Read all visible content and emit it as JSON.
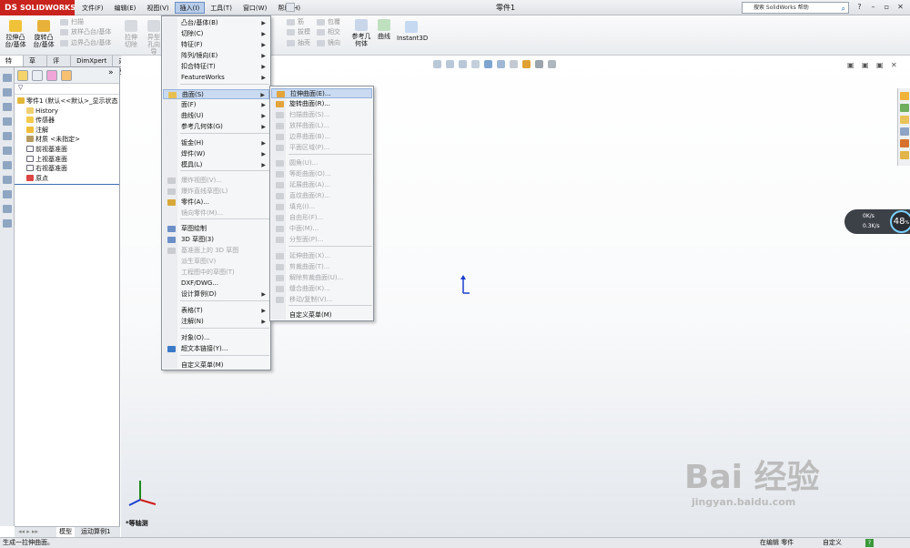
{
  "app": {
    "logo": "SOLIDWORKS",
    "title": "零件1"
  },
  "menubar": [
    "文件(F)",
    "编辑(E)",
    "视图(V)",
    "插入(I)",
    "工具(T)",
    "窗口(W)",
    "帮助(H)"
  ],
  "search": {
    "placeholder": "搜索 SolidWorks 帮助"
  },
  "ribbon": {
    "big": [
      "拉伸凸台/基体",
      "旋转凸台/基体"
    ],
    "small_left": [
      "扫描",
      "放样凸台/基体",
      "边界凸台/基体"
    ],
    "mid_big": [
      "拉伸切除",
      "异型孔向导"
    ],
    "right_small": [
      "筋",
      "包覆",
      "拔模",
      "相交",
      "抽壳",
      "镜向"
    ],
    "ref": "参考几何体",
    "curve": "曲线",
    "instant": "Instant3D"
  },
  "tabs": [
    "特征",
    "草图",
    "评估",
    "DimXpert",
    "办公室产品"
  ],
  "tree": {
    "root": "零件1 (默认<<默认>_显示状态",
    "items": [
      "History",
      "传感器",
      "注解",
      "材质 <未指定>",
      "前视基准面",
      "上视基准面",
      "右视基准面",
      "原点"
    ]
  },
  "insert_menu": [
    {
      "label": "凸台/基体(B)",
      "sub": true
    },
    {
      "label": "切除(C)",
      "sub": true
    },
    {
      "label": "特征(F)",
      "sub": true
    },
    {
      "label": "阵列/镜向(E)",
      "sub": true
    },
    {
      "label": "扣合特征(T)",
      "sub": true
    },
    {
      "label": "FeatureWorks",
      "sub": true
    },
    {
      "label": "曲面(S)",
      "sub": true,
      "highlight": true
    },
    {
      "label": "面(F)",
      "sub": true
    },
    {
      "label": "曲线(U)",
      "sub": true
    },
    {
      "label": "参考几何体(G)",
      "sub": true
    },
    {
      "label": "钣金(H)",
      "sub": true
    },
    {
      "label": "焊件(W)",
      "sub": true
    },
    {
      "label": "模具(L)",
      "sub": true
    },
    {
      "label": "爆炸视图(V)...",
      "disabled": true
    },
    {
      "label": "爆炸直线草图(L)",
      "disabled": true
    },
    {
      "label": "零件(A)..."
    },
    {
      "label": "镜向零件(M)...",
      "disabled": true
    },
    {
      "label": "草图绘制"
    },
    {
      "label": "3D 草图(3)"
    },
    {
      "label": "基准面上的 3D 草图",
      "disabled": true
    },
    {
      "label": "派生草图(V)",
      "disabled": true
    },
    {
      "label": "工程图中的草图(T)",
      "disabled": true
    },
    {
      "label": "DXF/DWG..."
    },
    {
      "label": "设计算例(D)",
      "sub": true
    },
    {
      "label": "表格(T)",
      "sub": true
    },
    {
      "label": "注解(N)",
      "sub": true
    },
    {
      "label": "对象(O)..."
    },
    {
      "label": "超文本链接(Y)..."
    },
    {
      "label": "自定义菜单(M)"
    }
  ],
  "surface_menu": [
    {
      "label": "拉伸曲面(E)...",
      "highlight": true
    },
    {
      "label": "旋转曲面(R)..."
    },
    {
      "label": "扫描曲面(S)...",
      "disabled": true
    },
    {
      "label": "放样曲面(L)...",
      "disabled": true
    },
    {
      "label": "边界曲面(B)...",
      "disabled": true
    },
    {
      "label": "平面区域(P)...",
      "disabled": true
    },
    {
      "label": "圆角(U)...",
      "disabled": true
    },
    {
      "label": "等距曲面(O)...",
      "disabled": true
    },
    {
      "label": "延展曲面(A)...",
      "disabled": true
    },
    {
      "label": "直纹曲面(R)...",
      "disabled": true
    },
    {
      "label": "填充(I)...",
      "disabled": true
    },
    {
      "label": "自由形(F)...",
      "disabled": true
    },
    {
      "label": "中面(M)...",
      "disabled": true
    },
    {
      "label": "分型面(P)...",
      "disabled": true
    },
    {
      "label": "延伸曲面(X)...",
      "disabled": true
    },
    {
      "label": "剪裁曲面(T)...",
      "disabled": true
    },
    {
      "label": "解除剪裁曲面(U)...",
      "disabled": true
    },
    {
      "label": "缝合曲面(K)...",
      "disabled": true
    },
    {
      "label": "移动/复制(V)...",
      "disabled": true
    },
    {
      "label": "自定义菜单(M)"
    }
  ],
  "bottom_tabs": [
    "模型",
    "运动算例1"
  ],
  "triad_label": "*等轴测",
  "status": {
    "left": "生成一拉伸曲面。",
    "mode": "在编辑 零件",
    "custom": "自定义"
  },
  "speed": {
    "up": "0K/s",
    "down": "0.3K/s",
    "percent": "48",
    "percent_unit": "%"
  },
  "watermark": {
    "big": "Bai 经验",
    "small": "jingyan.baidu.com"
  },
  "colors": {
    "logo_red": "#c8231c",
    "highlight": "#c9daf1",
    "axis_blue": "#1a3fd0",
    "axis_red": "#d11a1a",
    "axis_green": "#1c8a1c"
  }
}
